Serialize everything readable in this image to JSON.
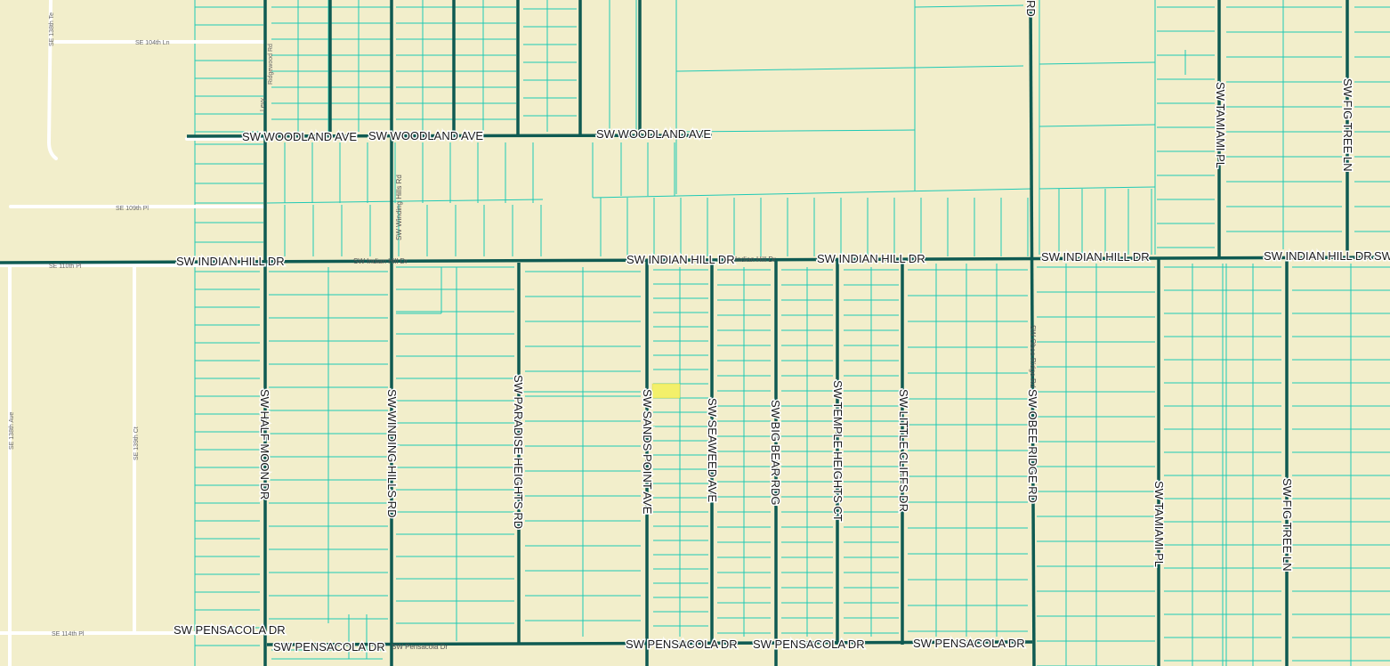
{
  "map": {
    "background_color": "#f2eecb",
    "parcel_color": "#1fc9b5",
    "road_color": "#0f5a52",
    "highlight_color": "#f3f06a"
  },
  "labels": {
    "woodland_1": "SW WOODLAND AVE",
    "woodland_2": "SW WOODLAND AVE",
    "woodland_3": "SW WOODLAND AVE",
    "indian_hill_1": "SW INDIAN HILL DR",
    "indian_hill_small": "SW Indian Hill Dr",
    "indian_hill_2": "SW INDIAN HILL DR",
    "indian_hill_small_2": "Indian Hill Dr",
    "indian_hill_3": "SW INDIAN HILL DR",
    "indian_hill_4": "SW INDIAN HILL DR",
    "indian_hill_5": "SW INDIAN HILL DR",
    "indian_hill_cut": "SW",
    "pensacola_1": "SW PENSACOLA DR",
    "pensacola_2": "SW PENSACOLA DR",
    "pensacola_small": "SW Pensacola Dr",
    "pensacola_3": "SW PENSACOLA DR",
    "pensacola_4": "SW PENSACOLA DR",
    "pensacola_5": "SW PENSACOLA DR",
    "half_moon": "SW HALF MOON DR",
    "winding_hills": "SW WINDING HILLS RD",
    "winding_hills_small": "SW Winding Hills Rd",
    "paradise_heights": "SW PARADISE HEIGHTS RD",
    "sands_point": "SW SANDS POINT AVE",
    "seaweed": "SW SEAWEED AVE",
    "big_bear": "SW BIG BEAR RDG",
    "temple_heights": "SW TEMPLE HEIGHTS CT",
    "little_cliffs": "SW LITTLE CLIFFS DR",
    "obee_ridge": "SW OBEE RIDGE RD",
    "obee_ridge_small": "SW Obee Ridge Rd",
    "obee_rd_top": "RD",
    "tamiami_1": "SW TAMIAMI PL",
    "tamiami_2": "SW TAMIAMI PL",
    "fig_tree_1": "SW FIG TREE LN",
    "fig_tree_2": "SW FIG TREE LN",
    "se_104th": "SE 104th Ln",
    "se_109th": "SE 109th Pl",
    "se_110th": "SE 110th Pl",
    "se_114th": "SE 114th Pl",
    "se_138th_ave": "SE 138th Ave",
    "se_139th_ct": "SE 139th Ct",
    "se_138th_top": "SE 138th Te",
    "ridgewood": "Ridgewood Rd",
    "levy": "Levy"
  }
}
